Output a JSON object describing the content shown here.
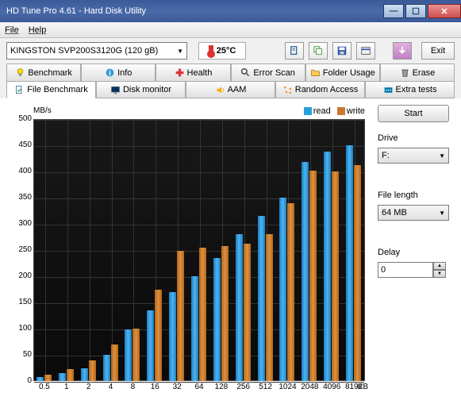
{
  "window": {
    "title": "HD Tune Pro 4.61 - Hard Disk Utility"
  },
  "menu": {
    "file": "File",
    "help": "Help"
  },
  "toolbar": {
    "drive": "KINGSTON SVP200S3120G (120 gB)",
    "temp": "25°C",
    "exit": "Exit"
  },
  "tabs_top": [
    {
      "label": "Benchmark",
      "icon": "bulb"
    },
    {
      "label": "Info",
      "icon": "info"
    },
    {
      "label": "Health",
      "icon": "health"
    },
    {
      "label": "Error Scan",
      "icon": "search"
    },
    {
      "label": "Folder Usage",
      "icon": "folder"
    },
    {
      "label": "Erase",
      "icon": "trash"
    }
  ],
  "tabs_bot": [
    {
      "label": "File Benchmark",
      "icon": "file",
      "active": true
    },
    {
      "label": "Disk monitor",
      "icon": "monitor"
    },
    {
      "label": "AAM",
      "icon": "speaker"
    },
    {
      "label": "Random Access",
      "icon": "random"
    },
    {
      "label": "Extra tests",
      "icon": "extra"
    }
  ],
  "side": {
    "start": "Start",
    "drive_label": "Drive",
    "drive_value": "F:",
    "filelen_label": "File length",
    "filelen_value": "64 MB",
    "delay_label": "Delay",
    "delay_value": "0"
  },
  "chart_data": {
    "type": "bar",
    "title": "",
    "ylabel": "MB/s",
    "xlabel": "KB",
    "ylim": [
      0,
      500
    ],
    "yticks": [
      0,
      50,
      100,
      150,
      200,
      250,
      300,
      350,
      400,
      450,
      500
    ],
    "categories": [
      "0.5",
      "1",
      "2",
      "4",
      "8",
      "16",
      "32",
      "64",
      "128",
      "256",
      "512",
      "1024",
      "2048",
      "4096",
      "8192"
    ],
    "series": [
      {
        "name": "read",
        "color": "#2a9fe0",
        "values": [
          8,
          15,
          25,
          50,
          98,
          135,
          170,
          200,
          235,
          280,
          315,
          350,
          418,
          438,
          450
        ]
      },
      {
        "name": "write",
        "color": "#c77a2e",
        "values": [
          12,
          22,
          40,
          70,
          100,
          175,
          248,
          255,
          258,
          262,
          280,
          340,
          402,
          400,
          412
        ]
      }
    ],
    "legend": [
      "read",
      "write"
    ]
  }
}
